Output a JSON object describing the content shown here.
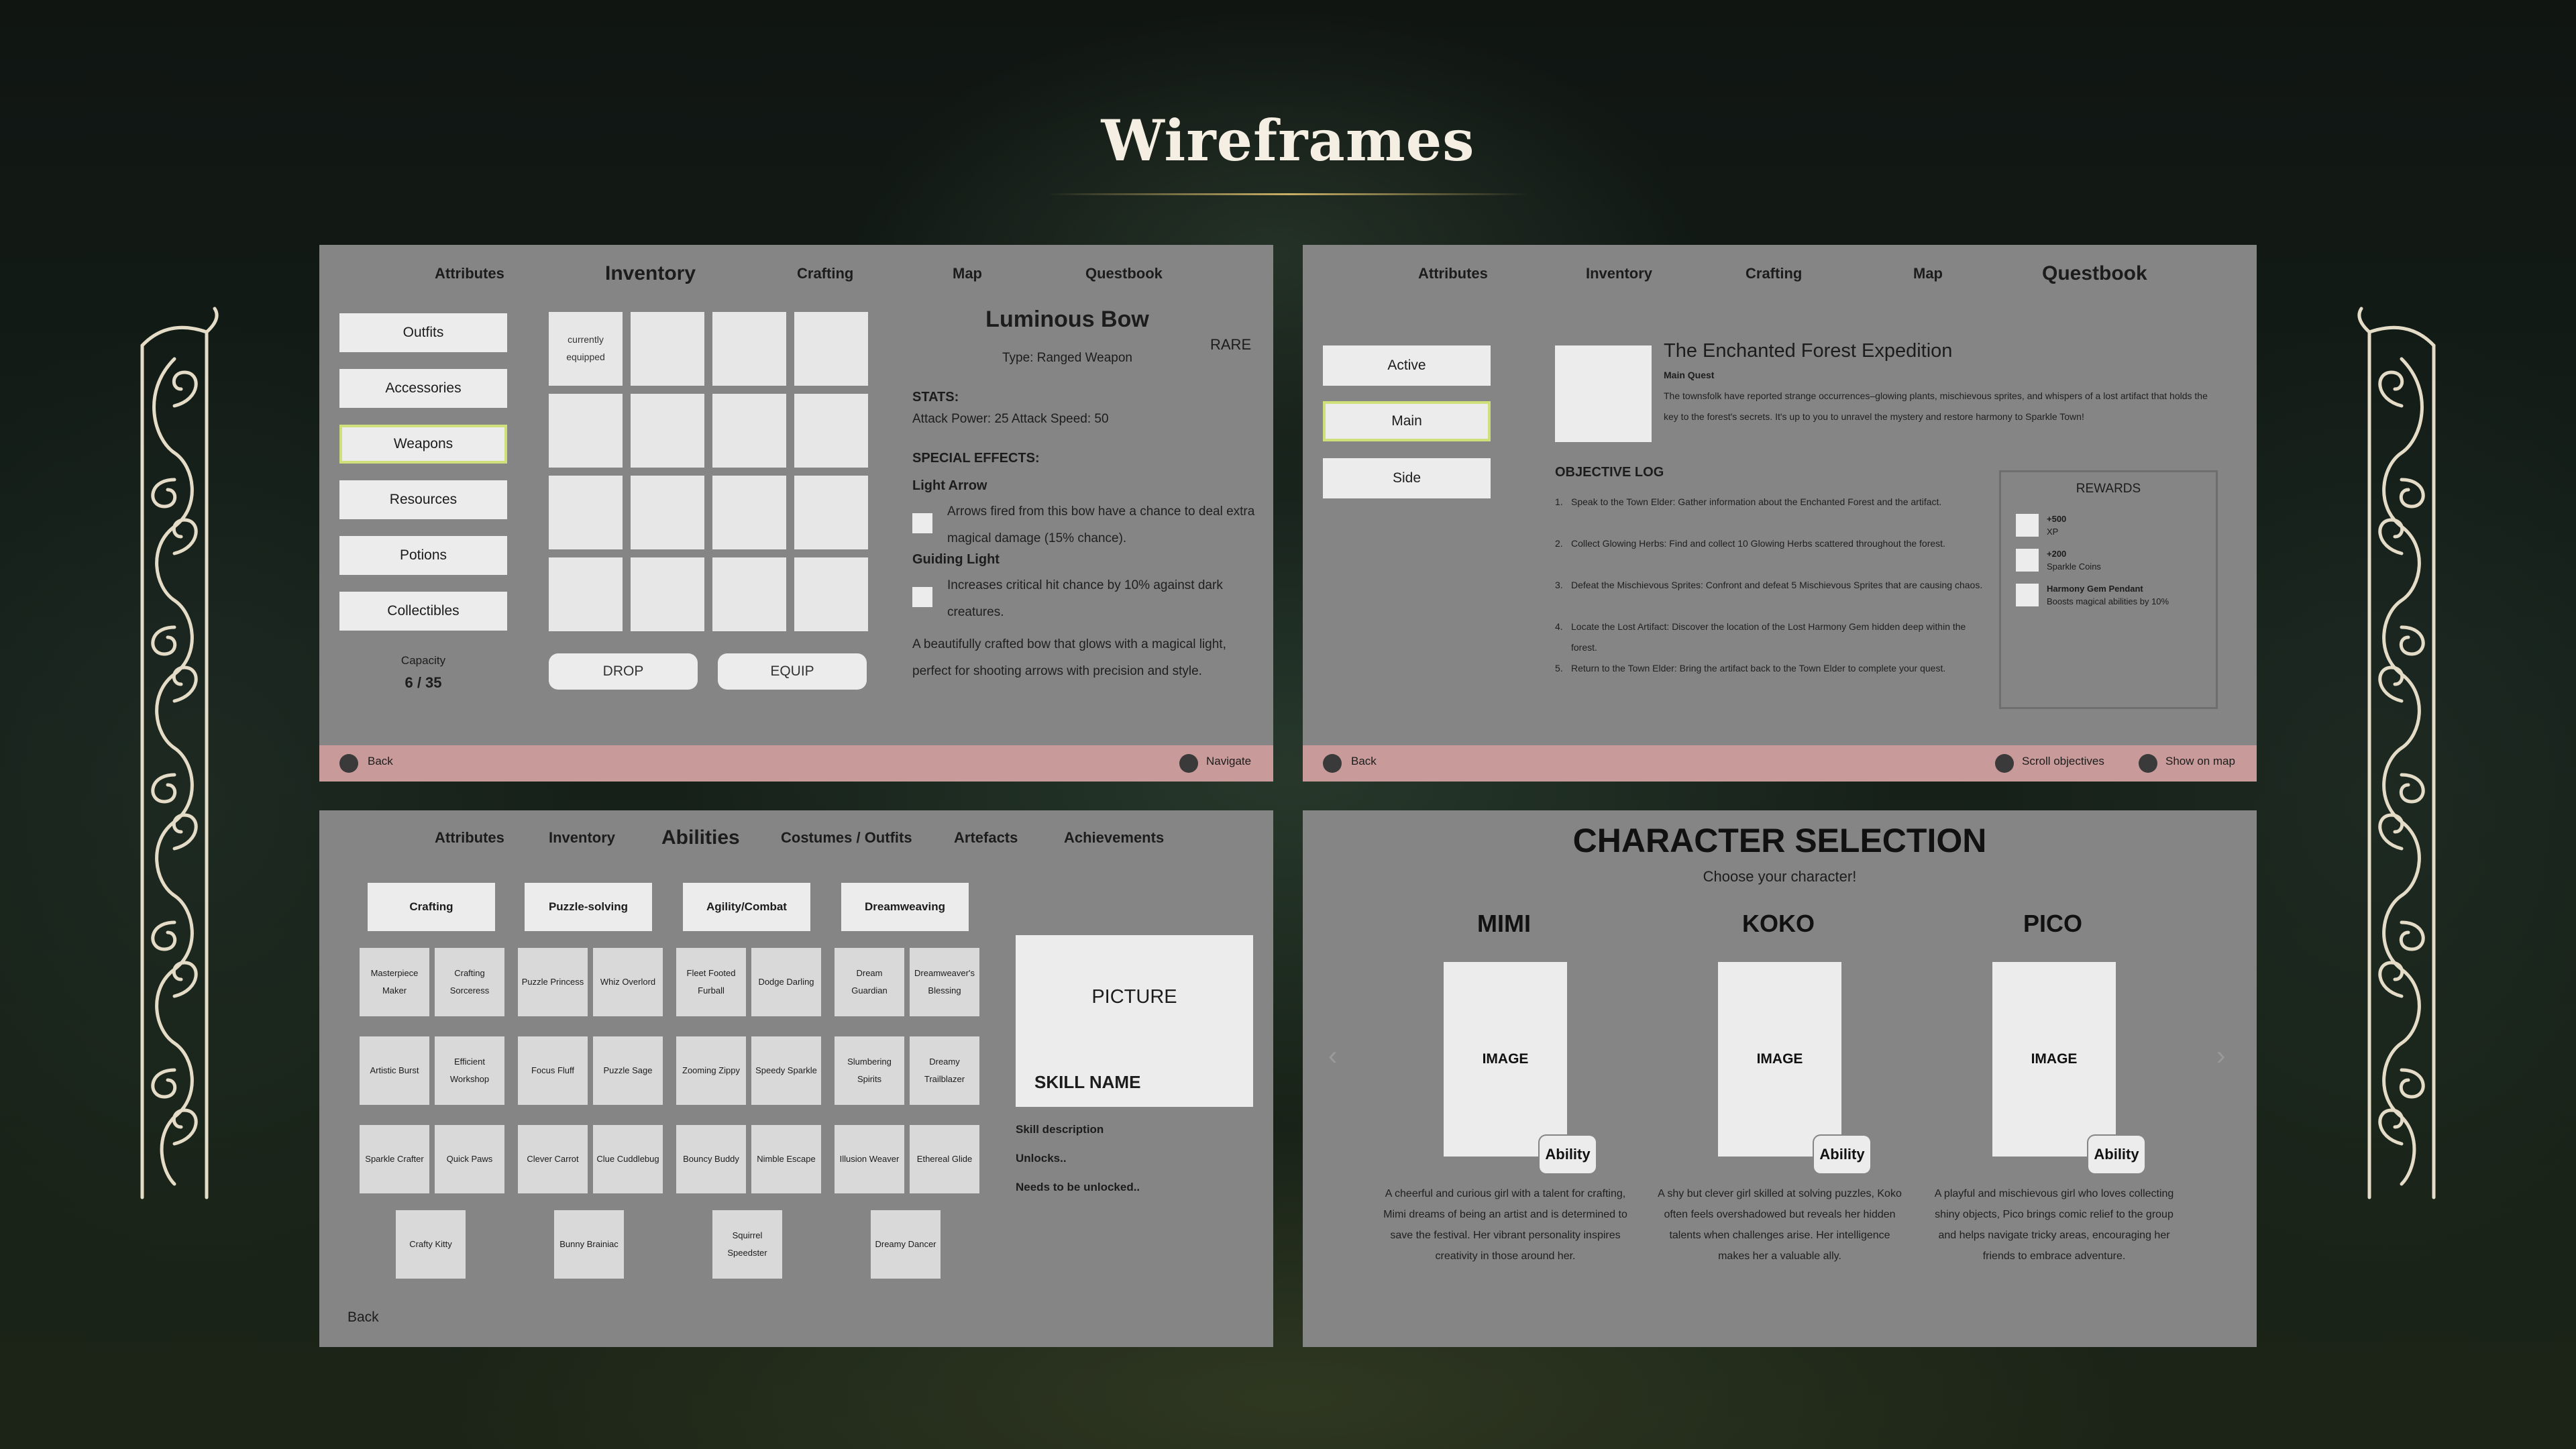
{
  "page_title": "Wireframes",
  "inventory": {
    "tabs": [
      "Attributes",
      "Inventory",
      "Crafting",
      "Map",
      "Questbook"
    ],
    "categories": [
      "Outfits",
      "Accessories",
      "Weapons",
      "Resources",
      "Potions",
      "Collectibles"
    ],
    "selected_category": "Weapons",
    "capacity_label": "Capacity",
    "capacity_value": "6 / 35",
    "equipped_line1": "currently",
    "equipped_line2": "equipped",
    "drop_label": "DROP",
    "equip_label": "EQUIP",
    "item": {
      "name": "Luminous Bow",
      "rarity": "RARE",
      "type": "Type: Ranged Weapon",
      "stats_heading": "STATS:",
      "stats": "Attack Power: 25 Attack Speed: 50",
      "effects_heading": "SPECIAL EFFECTS:",
      "effect1_name": "Light Arrow",
      "effect1_desc": "Arrows fired from this bow have a chance to deal extra magical damage (15% chance).",
      "effect2_name": "Guiding Light",
      "effect2_desc": "Increases critical hit chance by 10% against dark creatures.",
      "description": "A beautifully crafted bow that glows with a magical light, perfect for shooting arrows with precision and style."
    },
    "footer": {
      "back": "Back",
      "navigate": "Navigate"
    }
  },
  "questbook": {
    "tabs": [
      "Attributes",
      "Inventory",
      "Crafting",
      "Map",
      "Questbook"
    ],
    "filters": [
      "Active",
      "Main",
      "Side"
    ],
    "selected_filter": "Main",
    "quest_title": "The Enchanted Forest Expedition",
    "quest_type": "Main Quest",
    "quest_desc": "The townsfolk have reported strange occurrences–glowing plants, mischievous sprites, and whispers of a lost artifact that holds the key to the forest's secrets. It's up to you to unravel the mystery and restore harmony to Sparkle Town!",
    "objective_heading": "OBJECTIVE LOG",
    "objectives": [
      "Speak to the Town Elder: Gather information about the Enchanted Forest and the artifact.",
      "Collect Glowing Herbs: Find and collect 10 Glowing Herbs scattered throughout the forest.",
      "Defeat the Mischievous Sprites: Confront and defeat 5 Mischievous Sprites that are causing chaos.",
      "Locate the Lost Artifact: Discover the location of the Lost Harmony Gem hidden deep within the forest.",
      "Return to the Town Elder: Bring the artifact back to the Town Elder to complete your quest."
    ],
    "rewards_heading": "REWARDS",
    "rewards": [
      {
        "title": "+500",
        "sub": "XP"
      },
      {
        "title": "+200",
        "sub": "Sparkle Coins"
      },
      {
        "title": "Harmony Gem Pendant",
        "sub": "Boosts magical abilities by 10%"
      }
    ],
    "footer": {
      "back": "Back",
      "scroll": "Scroll objectives",
      "map": "Show on map"
    }
  },
  "abilities": {
    "tabs": [
      "Attributes",
      "Inventory",
      "Abilities",
      "Costumes / Outfits",
      "Artefacts",
      "Achievements"
    ],
    "categories": [
      "Crafting",
      "Puzzle-solving",
      "Agility/Combat",
      "Dreamweaving"
    ],
    "skills": {
      "c1": [
        "Masterpiece Maker",
        "Crafting Sorceress",
        "Artistic Burst",
        "Efficient Workshop",
        "Sparkle Crafter",
        "Quick Paws",
        "Crafty Kitty"
      ],
      "c2": [
        "Puzzle Princess",
        "Whiz Overlord",
        "Focus Fluff",
        "Puzzle Sage",
        "Clever Carrot",
        "Clue Cuddlebug",
        "Bunny Brainiac"
      ],
      "c3": [
        "Fleet Footed Furball",
        "Dodge Darling",
        "Zooming Zippy",
        "Speedy Sparkle",
        "Bouncy Buddy",
        "Nimble Escape",
        "Squirrel Speedster"
      ],
      "c4": [
        "Dream Guardian",
        "Dreamweaver's Blessing",
        "Slumbering Spirits",
        "Dreamy Trailblazer",
        "Illusion Weaver",
        "Ethereal Glide",
        "Dreamy Dancer"
      ]
    },
    "picture_label": "PICTURE",
    "skill_name_label": "SKILL NAME",
    "skill_description": "Skill description",
    "unlocks": "Unlocks..",
    "needs": "Needs to be unlocked..",
    "back": "Back"
  },
  "characters": {
    "title": "CHARACTER SELECTION",
    "subtitle": "Choose your character!",
    "image_label": "IMAGE",
    "ability_label": "Ability",
    "list": [
      {
        "name": "MIMI",
        "desc": "A cheerful and curious girl with a talent for crafting, Mimi dreams of being an artist and is determined to save the festival. Her vibrant personality inspires creativity in those around her."
      },
      {
        "name": "KOKO",
        "desc": "A shy but clever girl skilled at solving puzzles, Koko often feels overshadowed but reveals her hidden talents when challenges arise. Her intelligence makes her a valuable ally."
      },
      {
        "name": "PICO",
        "desc": "A playful and mischievous girl who loves collecting shiny objects, Pico brings comic relief to the group and helps navigate tricky areas, encouraging her friends to embrace adventure."
      }
    ]
  },
  "icons": {
    "ornament": "filigree-border-ornament",
    "controller_button": "round-controller-button-icon",
    "arrow_left": "chevron-left-icon",
    "arrow_right": "chevron-right-icon"
  },
  "colors": {
    "panel": "#858585",
    "footer": "#c99a9a",
    "selected_outline": "#cfe07a",
    "title": "#f4efe2"
  }
}
